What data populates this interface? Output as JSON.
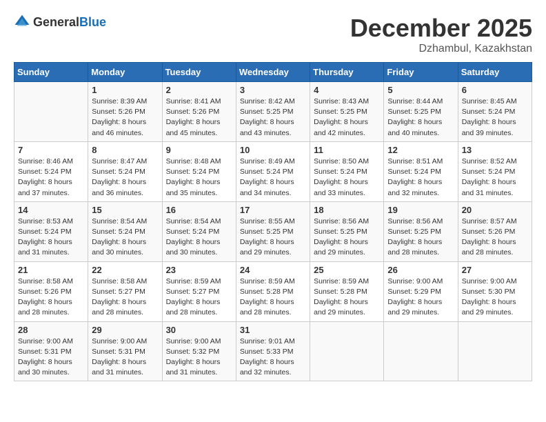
{
  "header": {
    "logo_general": "General",
    "logo_blue": "Blue",
    "month_title": "December 2025",
    "location": "Dzhambul, Kazakhstan"
  },
  "days_of_week": [
    "Sunday",
    "Monday",
    "Tuesday",
    "Wednesday",
    "Thursday",
    "Friday",
    "Saturday"
  ],
  "weeks": [
    [
      {
        "day": "",
        "sunrise": "",
        "sunset": "",
        "daylight": ""
      },
      {
        "day": "1",
        "sunrise": "Sunrise: 8:39 AM",
        "sunset": "Sunset: 5:26 PM",
        "daylight": "Daylight: 8 hours and 46 minutes."
      },
      {
        "day": "2",
        "sunrise": "Sunrise: 8:41 AM",
        "sunset": "Sunset: 5:26 PM",
        "daylight": "Daylight: 8 hours and 45 minutes."
      },
      {
        "day": "3",
        "sunrise": "Sunrise: 8:42 AM",
        "sunset": "Sunset: 5:25 PM",
        "daylight": "Daylight: 8 hours and 43 minutes."
      },
      {
        "day": "4",
        "sunrise": "Sunrise: 8:43 AM",
        "sunset": "Sunset: 5:25 PM",
        "daylight": "Daylight: 8 hours and 42 minutes."
      },
      {
        "day": "5",
        "sunrise": "Sunrise: 8:44 AM",
        "sunset": "Sunset: 5:25 PM",
        "daylight": "Daylight: 8 hours and 40 minutes."
      },
      {
        "day": "6",
        "sunrise": "Sunrise: 8:45 AM",
        "sunset": "Sunset: 5:24 PM",
        "daylight": "Daylight: 8 hours and 39 minutes."
      }
    ],
    [
      {
        "day": "7",
        "sunrise": "Sunrise: 8:46 AM",
        "sunset": "Sunset: 5:24 PM",
        "daylight": "Daylight: 8 hours and 37 minutes."
      },
      {
        "day": "8",
        "sunrise": "Sunrise: 8:47 AM",
        "sunset": "Sunset: 5:24 PM",
        "daylight": "Daylight: 8 hours and 36 minutes."
      },
      {
        "day": "9",
        "sunrise": "Sunrise: 8:48 AM",
        "sunset": "Sunset: 5:24 PM",
        "daylight": "Daylight: 8 hours and 35 minutes."
      },
      {
        "day": "10",
        "sunrise": "Sunrise: 8:49 AM",
        "sunset": "Sunset: 5:24 PM",
        "daylight": "Daylight: 8 hours and 34 minutes."
      },
      {
        "day": "11",
        "sunrise": "Sunrise: 8:50 AM",
        "sunset": "Sunset: 5:24 PM",
        "daylight": "Daylight: 8 hours and 33 minutes."
      },
      {
        "day": "12",
        "sunrise": "Sunrise: 8:51 AM",
        "sunset": "Sunset: 5:24 PM",
        "daylight": "Daylight: 8 hours and 32 minutes."
      },
      {
        "day": "13",
        "sunrise": "Sunrise: 8:52 AM",
        "sunset": "Sunset: 5:24 PM",
        "daylight": "Daylight: 8 hours and 31 minutes."
      }
    ],
    [
      {
        "day": "14",
        "sunrise": "Sunrise: 8:53 AM",
        "sunset": "Sunset: 5:24 PM",
        "daylight": "Daylight: 8 hours and 31 minutes."
      },
      {
        "day": "15",
        "sunrise": "Sunrise: 8:54 AM",
        "sunset": "Sunset: 5:24 PM",
        "daylight": "Daylight: 8 hours and 30 minutes."
      },
      {
        "day": "16",
        "sunrise": "Sunrise: 8:54 AM",
        "sunset": "Sunset: 5:24 PM",
        "daylight": "Daylight: 8 hours and 30 minutes."
      },
      {
        "day": "17",
        "sunrise": "Sunrise: 8:55 AM",
        "sunset": "Sunset: 5:25 PM",
        "daylight": "Daylight: 8 hours and 29 minutes."
      },
      {
        "day": "18",
        "sunrise": "Sunrise: 8:56 AM",
        "sunset": "Sunset: 5:25 PM",
        "daylight": "Daylight: 8 hours and 29 minutes."
      },
      {
        "day": "19",
        "sunrise": "Sunrise: 8:56 AM",
        "sunset": "Sunset: 5:25 PM",
        "daylight": "Daylight: 8 hours and 28 minutes."
      },
      {
        "day": "20",
        "sunrise": "Sunrise: 8:57 AM",
        "sunset": "Sunset: 5:26 PM",
        "daylight": "Daylight: 8 hours and 28 minutes."
      }
    ],
    [
      {
        "day": "21",
        "sunrise": "Sunrise: 8:58 AM",
        "sunset": "Sunset: 5:26 PM",
        "daylight": "Daylight: 8 hours and 28 minutes."
      },
      {
        "day": "22",
        "sunrise": "Sunrise: 8:58 AM",
        "sunset": "Sunset: 5:27 PM",
        "daylight": "Daylight: 8 hours and 28 minutes."
      },
      {
        "day": "23",
        "sunrise": "Sunrise: 8:59 AM",
        "sunset": "Sunset: 5:27 PM",
        "daylight": "Daylight: 8 hours and 28 minutes."
      },
      {
        "day": "24",
        "sunrise": "Sunrise: 8:59 AM",
        "sunset": "Sunset: 5:28 PM",
        "daylight": "Daylight: 8 hours and 28 minutes."
      },
      {
        "day": "25",
        "sunrise": "Sunrise: 8:59 AM",
        "sunset": "Sunset: 5:28 PM",
        "daylight": "Daylight: 8 hours and 29 minutes."
      },
      {
        "day": "26",
        "sunrise": "Sunrise: 9:00 AM",
        "sunset": "Sunset: 5:29 PM",
        "daylight": "Daylight: 8 hours and 29 minutes."
      },
      {
        "day": "27",
        "sunrise": "Sunrise: 9:00 AM",
        "sunset": "Sunset: 5:30 PM",
        "daylight": "Daylight: 8 hours and 29 minutes."
      }
    ],
    [
      {
        "day": "28",
        "sunrise": "Sunrise: 9:00 AM",
        "sunset": "Sunset: 5:31 PM",
        "daylight": "Daylight: 8 hours and 30 minutes."
      },
      {
        "day": "29",
        "sunrise": "Sunrise: 9:00 AM",
        "sunset": "Sunset: 5:31 PM",
        "daylight": "Daylight: 8 hours and 31 minutes."
      },
      {
        "day": "30",
        "sunrise": "Sunrise: 9:00 AM",
        "sunset": "Sunset: 5:32 PM",
        "daylight": "Daylight: 8 hours and 31 minutes."
      },
      {
        "day": "31",
        "sunrise": "Sunrise: 9:01 AM",
        "sunset": "Sunset: 5:33 PM",
        "daylight": "Daylight: 8 hours and 32 minutes."
      },
      {
        "day": "",
        "sunrise": "",
        "sunset": "",
        "daylight": ""
      },
      {
        "day": "",
        "sunrise": "",
        "sunset": "",
        "daylight": ""
      },
      {
        "day": "",
        "sunrise": "",
        "sunset": "",
        "daylight": ""
      }
    ]
  ]
}
